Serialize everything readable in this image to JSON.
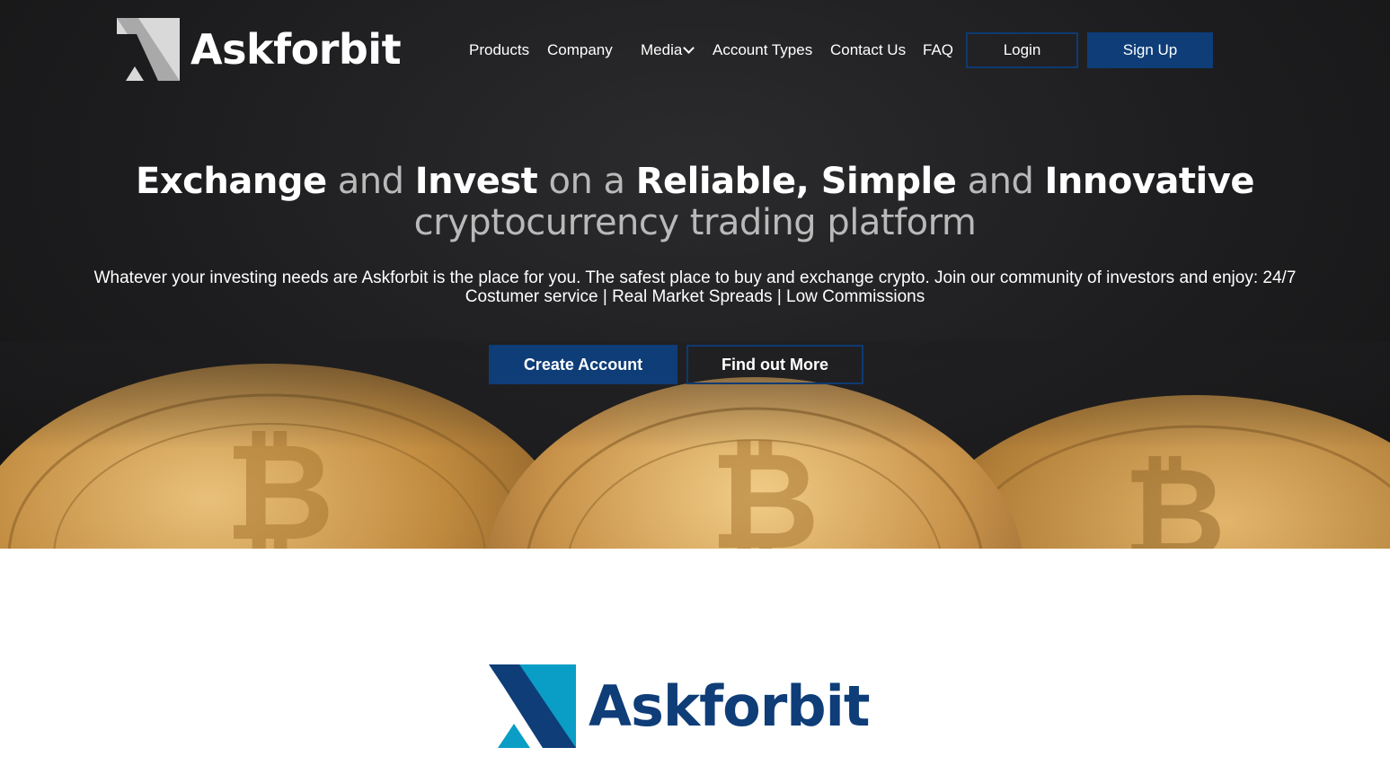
{
  "brand": {
    "name": "Askforbit"
  },
  "nav": {
    "items": [
      {
        "label": "Products"
      },
      {
        "label": "Company"
      },
      {
        "label": "Media"
      },
      {
        "label": "Account Types"
      },
      {
        "label": "Contact Us"
      },
      {
        "label": "FAQ"
      }
    ],
    "login_label": "Login",
    "signup_label": "Sign Up"
  },
  "hero": {
    "headline": {
      "w1": "Exchange",
      "w2": " and ",
      "w3": "Invest",
      "w4": " on a ",
      "w5": "Reliable, Simple",
      "w6": " and ",
      "w7": "Innovative"
    },
    "subline": "cryptocurrency trading platform",
    "description": "Whatever your investing needs are Askforbit is the place for you. The safest place to buy and exchange crypto. Join our community of investors and enjoy: 24/7 Costumer service | Real Market Spreads | Low Commissions",
    "create_account_label": "Create Account",
    "find_out_more_label": "Find out More"
  },
  "footer_logo": {
    "name": "Askforbit"
  },
  "colors": {
    "primary": "#0e3d78",
    "accent": "#0aa0c8",
    "hero_bg": "#1d1d1f",
    "coin_gold": "#c79a4a"
  }
}
